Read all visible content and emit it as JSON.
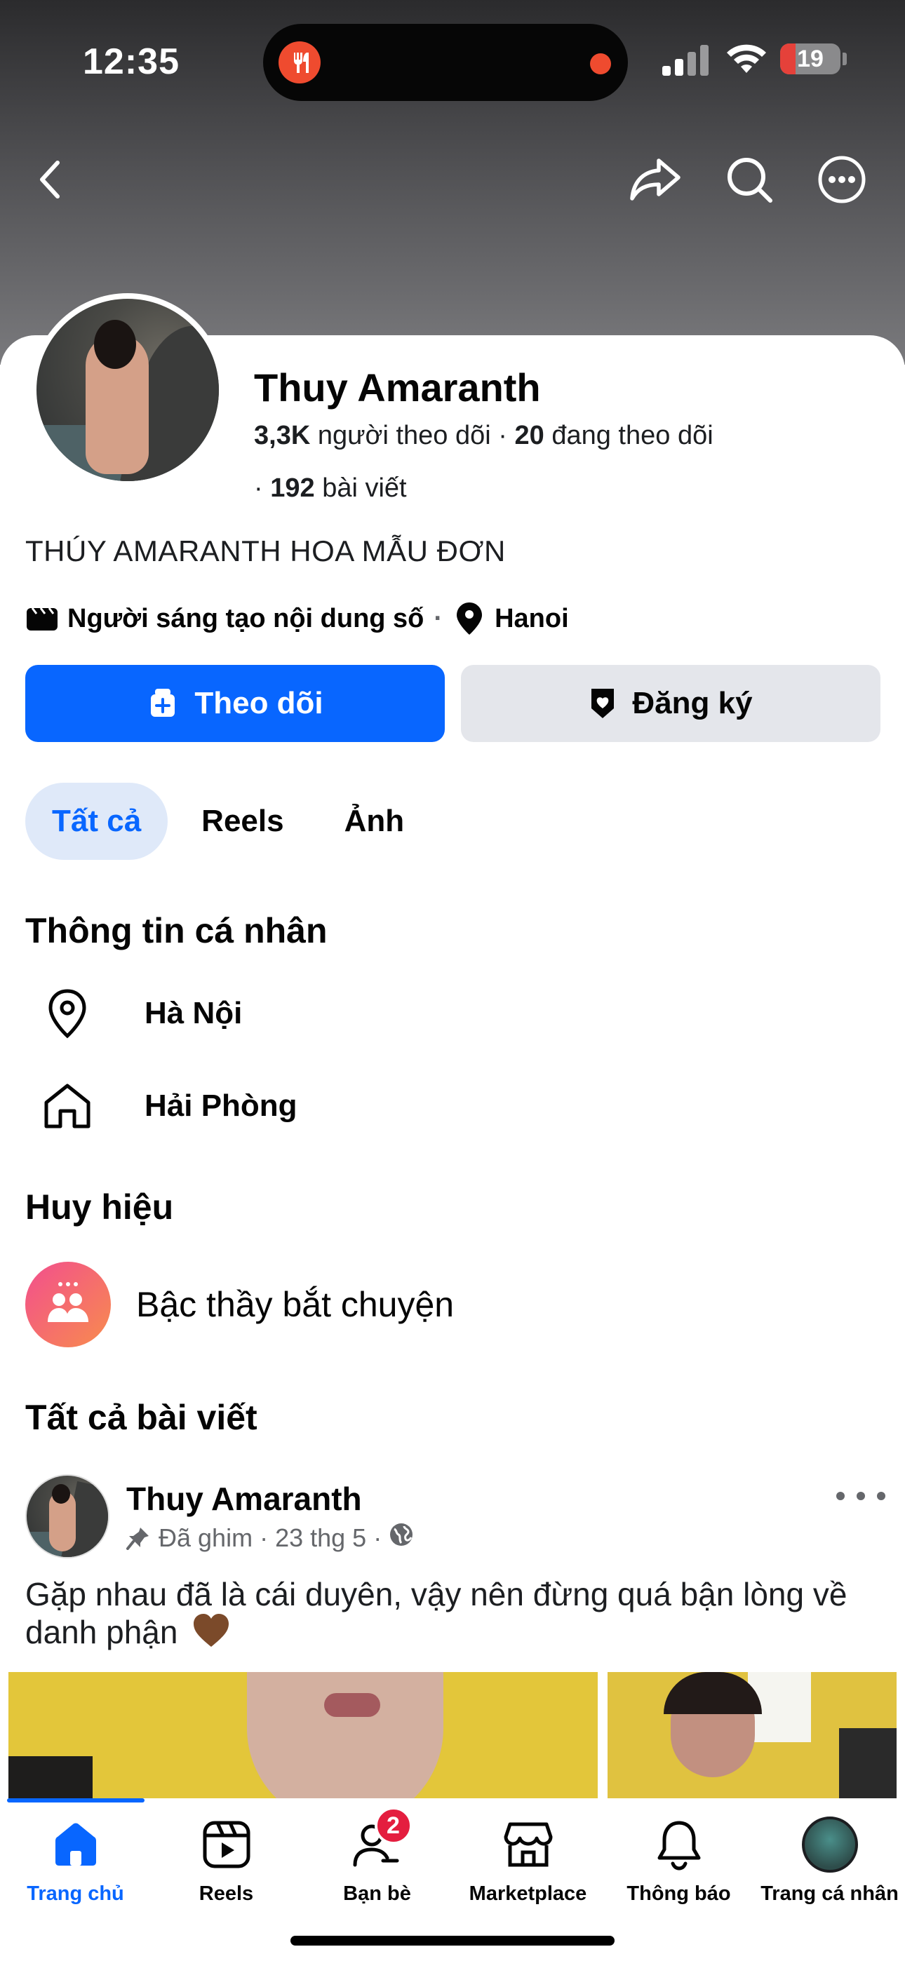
{
  "status_bar": {
    "time": "12:35",
    "battery": "19"
  },
  "profile": {
    "name": "Thuy Amaranth",
    "followers_count": "3,3K",
    "followers_label": "người theo dõi",
    "following_count": "20",
    "following_label": "đang theo dõi",
    "posts_count": "192",
    "posts_label": "bài viết",
    "bio": "THÚY AMARANTH HOA MẪU ĐƠN",
    "category": "Người sáng tạo nội dung số",
    "location": "Hanoi"
  },
  "actions": {
    "follow_label": "Theo dõi",
    "subscribe_label": "Đăng ký"
  },
  "tabs": [
    {
      "label": "Tất cả",
      "active": true
    },
    {
      "label": "Reels",
      "active": false
    },
    {
      "label": "Ảnh",
      "active": false
    }
  ],
  "personal_info": {
    "title": "Thông tin cá nhân",
    "current_city": "Hà Nội",
    "hometown": "Hải Phòng"
  },
  "badges": {
    "title": "Huy hiệu",
    "items": [
      {
        "label": "Bậc thầy bắt chuyện",
        "icon": "conversation-starter-icon"
      }
    ]
  },
  "posts_section": {
    "title": "Tất cả bài viết",
    "post": {
      "author": "Thuy Amaranth",
      "pinned_label": "Đã ghim",
      "date": "23 thg 5",
      "text": "Gặp nhau đã là cái duyên, vậy nên đừng quá bận lòng về danh phận"
    }
  },
  "bottom_nav": [
    {
      "label": "Trang chủ",
      "icon": "home-icon",
      "active": true
    },
    {
      "label": "Reels",
      "icon": "reels-icon",
      "active": false
    },
    {
      "label": "Bạn bè",
      "icon": "friends-icon",
      "active": false,
      "badge": "2"
    },
    {
      "label": "Marketplace",
      "icon": "marketplace-icon",
      "active": false
    },
    {
      "label": "Thông báo",
      "icon": "bell-icon",
      "active": false
    },
    {
      "label": "Trang cá nhân",
      "icon": "profile-avatar-icon",
      "active": false
    }
  ],
  "colors": {
    "accent": "#0866ff",
    "badge_red": "#e41e3f",
    "muted": "#65676b"
  }
}
